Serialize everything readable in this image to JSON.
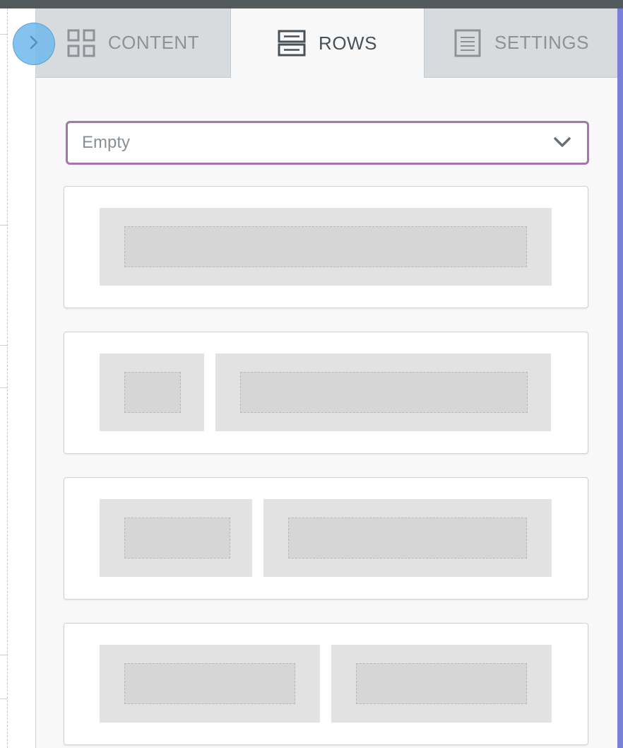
{
  "tabs": [
    {
      "label": "CONTENT",
      "icon": "grid-icon",
      "active": false
    },
    {
      "label": "ROWS",
      "icon": "rows-icon",
      "active": true
    },
    {
      "label": "SETTINGS",
      "icon": "document-icon",
      "active": false
    }
  ],
  "dropdown": {
    "selected": "Empty",
    "icon": "chevron-down-icon"
  },
  "row_layouts": [
    {
      "columns": 1
    },
    {
      "columns": 2,
      "ratio": "1:3"
    },
    {
      "columns": 2,
      "ratio": "1:2"
    },
    {
      "columns": 2,
      "ratio": "1:1"
    }
  ],
  "colors": {
    "accent_border": "#a775ad",
    "toggle_blue": "#6eb9eb",
    "right_edge": "#7b80d8"
  }
}
